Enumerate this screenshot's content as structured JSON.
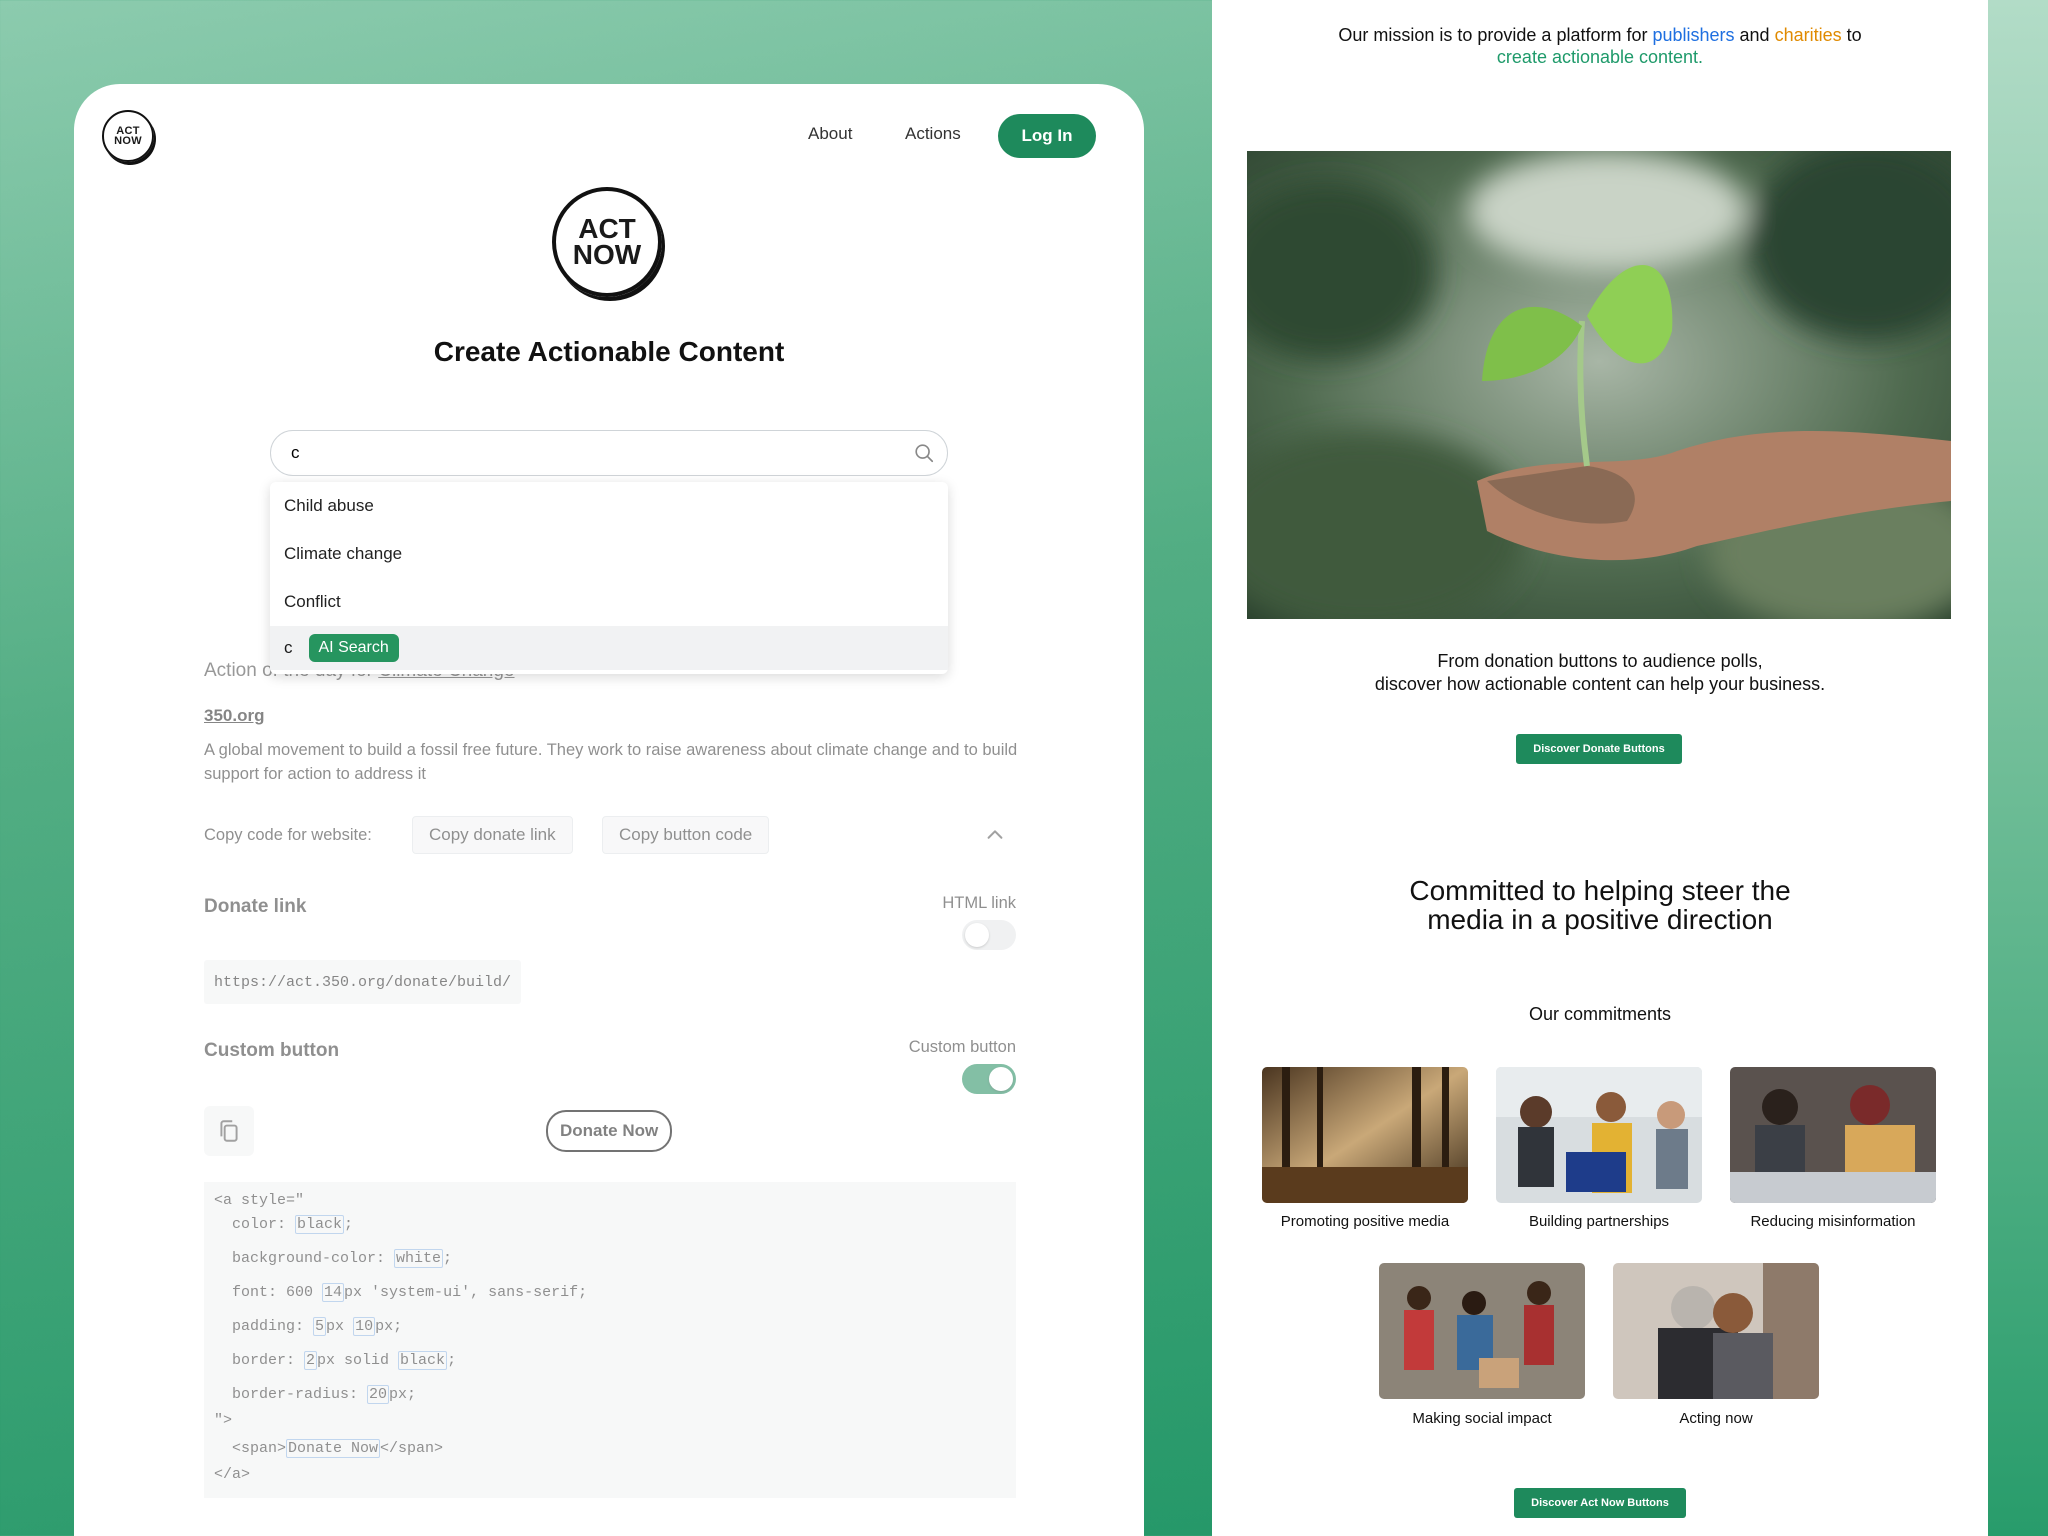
{
  "nav": {
    "about": "About",
    "actions": "Actions",
    "login": "Log In",
    "logo_line1": "ACT",
    "logo_line2": "NOW"
  },
  "main": {
    "logo_line1": "ACT",
    "logo_line2": "NOW",
    "title": "Create Actionable Content"
  },
  "search": {
    "value": "c",
    "suggestions": [
      "Child abuse",
      "Climate change",
      "Conflict"
    ],
    "ai_query": "c",
    "ai_label": "AI Search"
  },
  "action": {
    "prefix": "Action of the day for ",
    "topic": "Climate Change",
    "org_name": "350.org",
    "description": "A global movement to build a fossil free future. They work to raise awareness about climate change and to build support for action to address it",
    "copy_label": "Copy code for website:",
    "copy_donate_link": "Copy donate link",
    "copy_button_code": "Copy button code"
  },
  "donate_link": {
    "title": "Donate link",
    "toggle_label": "HTML link",
    "toggle_on": false,
    "url": "https://act.350.org/donate/build/"
  },
  "custom_button": {
    "title": "Custom button",
    "toggle_label": "Custom button",
    "toggle_on": true,
    "preview_label": "Donate Now"
  },
  "code": {
    "l1": "<a style=\"",
    "color_key": "  color: ",
    "color_val": "black",
    "bg_key": "  background-color: ",
    "bg_val": "white",
    "font_key": "  font: 600 ",
    "font_size": "14",
    "font_rest": "px 'system-ui', sans-serif;",
    "pad_key": "  padding: ",
    "pad_v": "5",
    "pad_mid": "px ",
    "pad_h": "10",
    "border_key": "  border: ",
    "border_w": "2",
    "border_mid": "px solid ",
    "border_c": "black",
    "radius_key": "  border-radius: ",
    "radius_v": "20",
    "close_style": "\">",
    "span_open": "  <span>",
    "span_text": "Donate Now",
    "span_close": "</span>",
    "a_close": "</a>",
    "semi": ";",
    "px_semi": "px;"
  },
  "right": {
    "mission_pre": "Our mission is to provide a platform for ",
    "publishers": "publishers",
    "and": " and ",
    "charities": "charities",
    "to": " to",
    "mission_end": "create actionable content.",
    "tagline1": "From donation buttons to audience polls,",
    "tagline2": "discover how actionable content can help your business.",
    "btn_donate": "Discover Donate Buttons",
    "heading1": "Committed to helping steer the",
    "heading2": "media in a positive direction",
    "commitments_title": "Our commitments",
    "commitments": [
      "Promoting positive media",
      "Building partnerships",
      "Reducing misinformation",
      "Making social impact",
      "Acting now"
    ],
    "btn_actnow": "Discover Act Now Buttons"
  },
  "colors": {
    "brand_green": "#1e8a5c",
    "publishers": "#1e6fe0",
    "charities": "#e08a00",
    "mission_end": "#1e9a6a"
  }
}
